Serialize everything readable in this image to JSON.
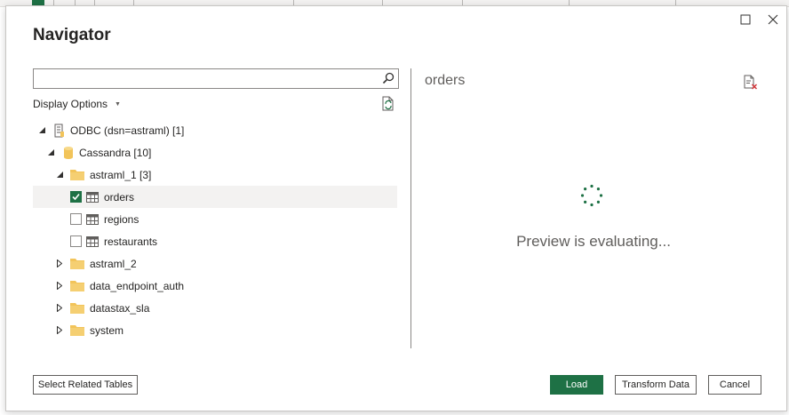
{
  "dialog": {
    "title": "Navigator"
  },
  "search": {
    "value": "",
    "placeholder": ""
  },
  "display_options_label": "Display Options",
  "tree": [
    {
      "label": "ODBC (dsn=astraml) [1]",
      "icon": "odbc-server-icon",
      "expanded": true
    },
    {
      "label": "Cassandra [10]",
      "icon": "database-cylinder-icon",
      "expanded": true
    },
    {
      "label": "astraml_1 [3]",
      "icon": "folder-icon",
      "expanded": true
    },
    {
      "label": "orders",
      "icon": "table-icon",
      "checked": true,
      "selected": true
    },
    {
      "label": "regions",
      "icon": "table-icon",
      "checked": false
    },
    {
      "label": "restaurants",
      "icon": "table-icon",
      "checked": false
    },
    {
      "label": "astraml_2",
      "icon": "folder-icon",
      "expanded": false
    },
    {
      "label": "data_endpoint_auth",
      "icon": "folder-icon",
      "expanded": false
    },
    {
      "label": "datastax_sla",
      "icon": "folder-icon",
      "expanded": false
    },
    {
      "label": "system",
      "icon": "folder-icon",
      "expanded": false
    }
  ],
  "preview": {
    "title": "orders",
    "status": "Preview is evaluating..."
  },
  "footer": {
    "select_related_label": "Select Related Tables",
    "load_label": "Load",
    "transform_label": "Transform Data",
    "cancel_label": "Cancel"
  },
  "colors": {
    "accent": "#1e7145",
    "folder": "#f2c45a",
    "table_icon": "#605e5c"
  }
}
